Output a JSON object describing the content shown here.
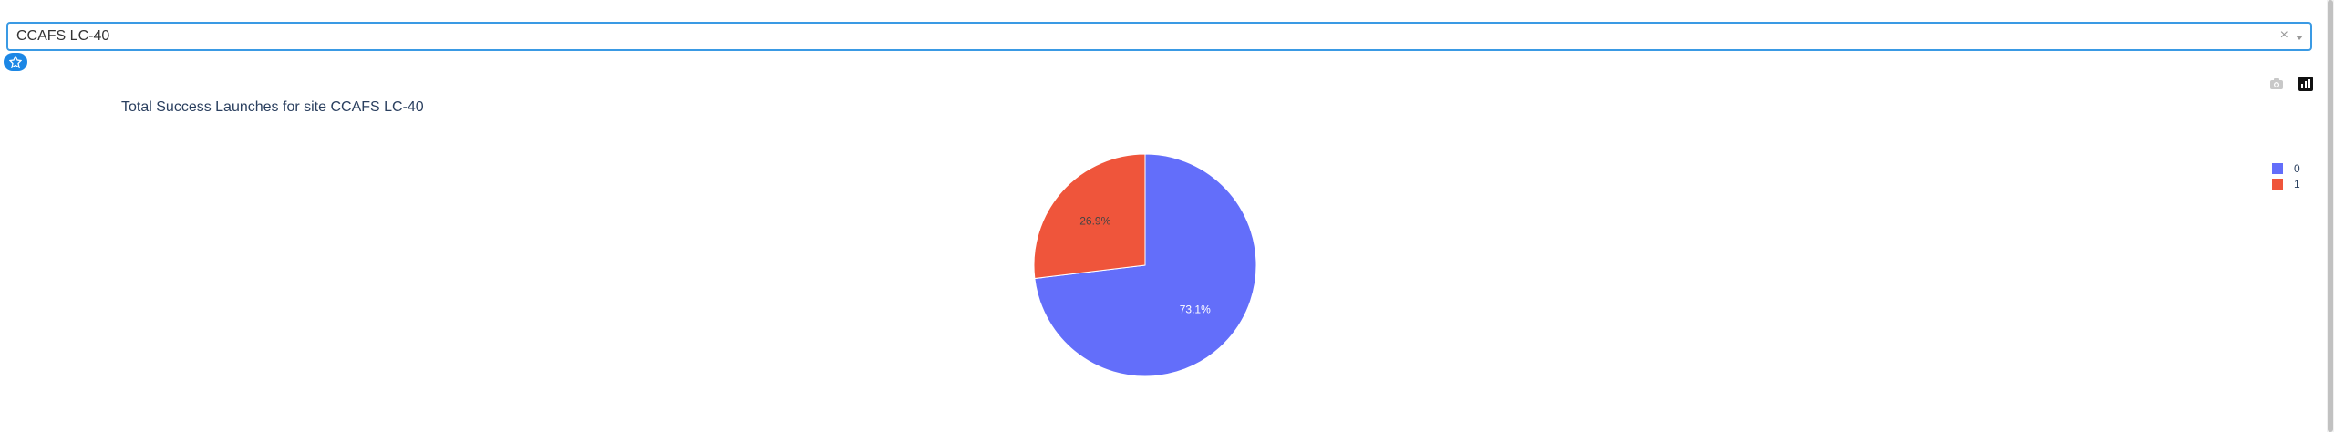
{
  "dropdown": {
    "selected_value": "CCAFS LC-40",
    "clear_symbol": "×"
  },
  "modebar": {
    "buttons": [
      "camera-icon",
      "plotly-logo-icon"
    ]
  },
  "chart_data": {
    "type": "pie",
    "title": "Total Success Launches for site CCAFS LC-40",
    "labels": [
      "0",
      "1"
    ],
    "values": [
      73.1,
      26.9
    ],
    "percent_labels": [
      "73.1%",
      "26.9%"
    ],
    "colors": [
      "#636efa",
      "#ef553b"
    ],
    "legend": [
      "0",
      "1"
    ],
    "legend_position": "top-right"
  }
}
